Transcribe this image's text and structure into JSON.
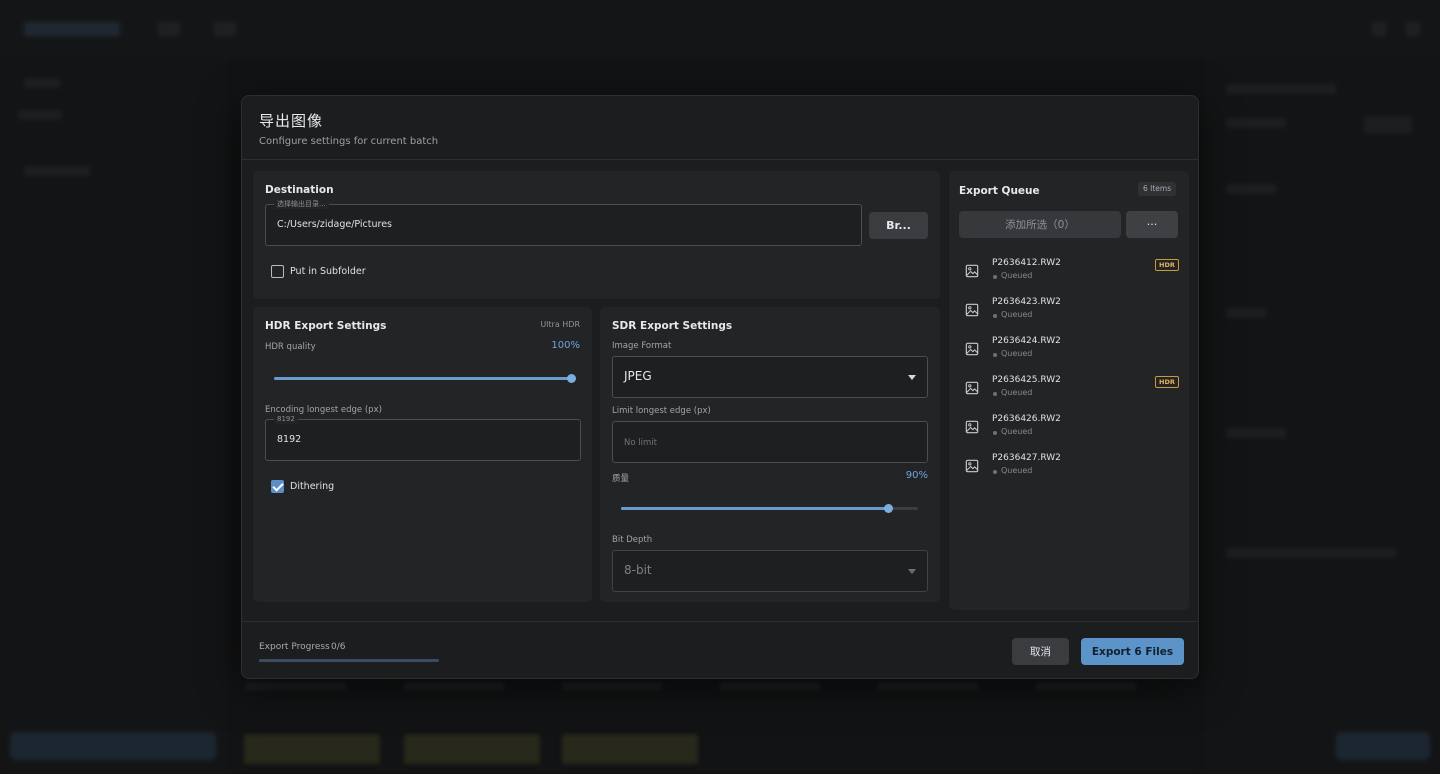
{
  "dialog": {
    "title": "导出图像",
    "subtitle": "Configure settings for current batch"
  },
  "destination": {
    "title": "Destination",
    "field_label": "选择输出目录...",
    "path": "C:/Users/zidage/Pictures",
    "browse_label": "Br...",
    "subfolder_label": "Put in Subfolder",
    "subfolder_checked": false
  },
  "hdr": {
    "title": "HDR Export Settings",
    "tag": "Ultra HDR",
    "quality_label": "HDR quality",
    "quality_value": "100%",
    "quality_fraction": 1.0,
    "edge_label": "Encoding longest edge (px)",
    "edge_field_label": "8192",
    "edge_value": "8192",
    "dithering_label": "Dithering",
    "dithering_checked": true
  },
  "sdr": {
    "title": "SDR Export Settings",
    "format_label": "Image Format",
    "format_value": "JPEG",
    "limit_label": "Limit longest edge (px)",
    "limit_placeholder": "No limit",
    "quality_label": "质量",
    "quality_value": "90%",
    "quality_fraction": 0.9,
    "bitdepth_label": "Bit Depth",
    "bitdepth_value": "8-bit"
  },
  "queue": {
    "title": "Export Queue",
    "count": "6 Items",
    "add_selected_label": "添加所选（0）",
    "more_label": "···",
    "hdr_badge": "HDR",
    "items": [
      {
        "name": "P2636412.RW2",
        "status": "Queued",
        "hdr": true
      },
      {
        "name": "P2636423.RW2",
        "status": "Queued",
        "hdr": false
      },
      {
        "name": "P2636424.RW2",
        "status": "Queued",
        "hdr": false
      },
      {
        "name": "P2636425.RW2",
        "status": "Queued",
        "hdr": true
      },
      {
        "name": "P2636426.RW2",
        "status": "Queued",
        "hdr": false
      },
      {
        "name": "P2636427.RW2",
        "status": "Queued",
        "hdr": false
      }
    ]
  },
  "footer": {
    "progress_label": "Export Progress",
    "progress_count": "0/6",
    "progress_fraction": 0,
    "cancel_label": "取消",
    "export_label": "Export 6 Files"
  },
  "colors": {
    "accent": "#5c94c9",
    "hdr_badge": "#e2b45a",
    "modal_bg": "#1c1d1f",
    "panel_bg": "#232426"
  },
  "icons": {
    "queue_item": "image-icon",
    "dropdown": "chevron-down-icon"
  }
}
